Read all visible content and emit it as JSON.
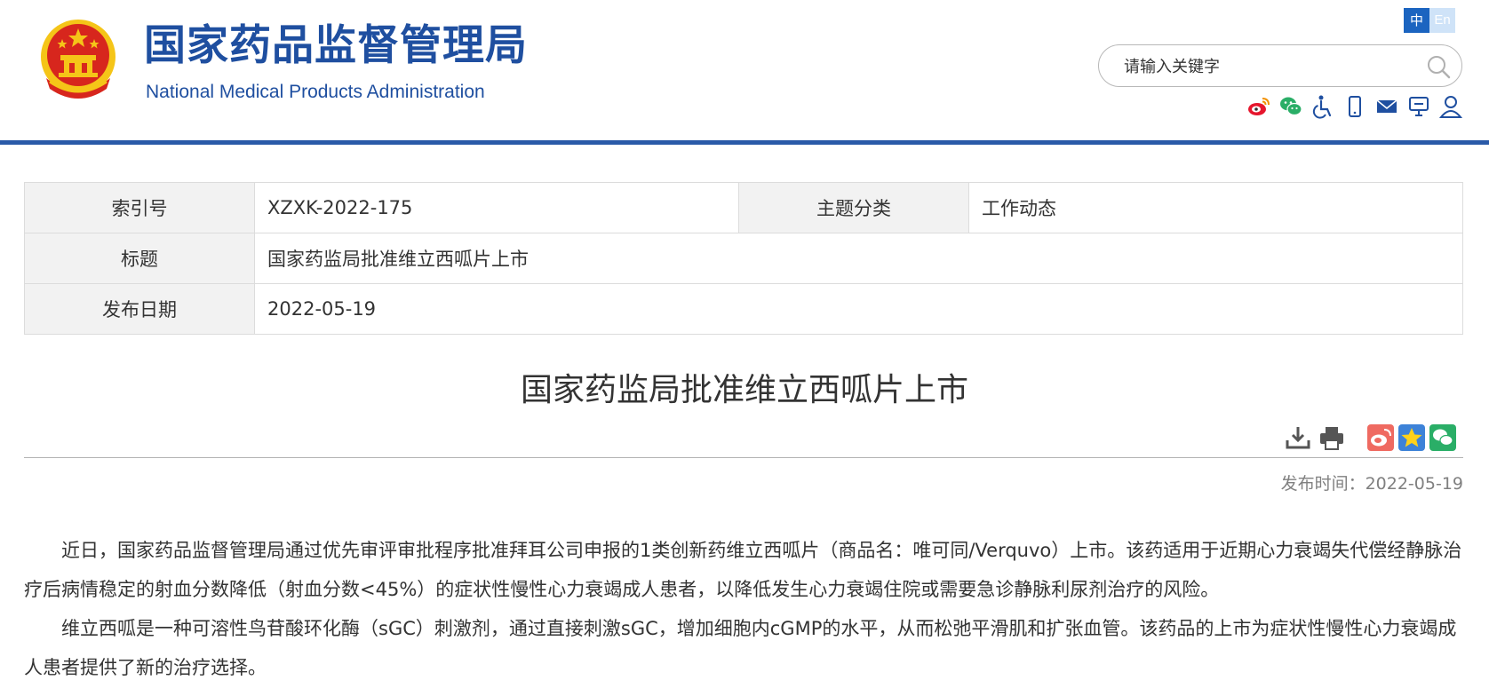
{
  "header": {
    "logo_cn": "国家药品监督管理局",
    "logo_en": "National Medical Products Administration",
    "lang_zh": "中",
    "lang_en": "En",
    "search_placeholder": "请输入关键字",
    "tool_icons": [
      "weibo-icon",
      "wechat-icon",
      "accessibility-icon",
      "mobile-icon",
      "mail-icon",
      "feedback-icon",
      "user-icon"
    ]
  },
  "info": {
    "index_label": "索引号",
    "index_value": "XZXK-2022-175",
    "category_label": "主题分类",
    "category_value": "工作动态",
    "title_label": "标题",
    "title_value": "国家药监局批准维立西呱片上市",
    "date_label": "发布日期",
    "date_value": "2022-05-19"
  },
  "article": {
    "title": "国家药监局批准维立西呱片上市",
    "pubtime": "发布时间：2022-05-19",
    "paragraphs": [
      "近日，国家药品监督管理局通过优先审评审批程序批准拜耳公司申报的1类创新药维立西呱片（商品名：唯可同/Verquvo）上市。该药适用于近期心力衰竭失代偿经静脉治疗后病情稳定的射血分数降低（射血分数<45%）的症状性慢性心力衰竭成人患者，以降低发生心力衰竭住院或需要急诊静脉利尿剂治疗的风险。",
      "维立西呱是一种可溶性鸟苷酸环化酶（sGC）刺激剂，通过直接刺激sGC，增加细胞内cGMP的水平，从而松弛平滑肌和扩张血管。该药品的上市为症状性慢性心力衰竭成人患者提供了新的治疗选择。"
    ],
    "action_icons": [
      "download-icon",
      "print-icon",
      "share-weibo-icon",
      "share-favorite-icon",
      "share-wechat-icon"
    ]
  },
  "colors": {
    "brand_blue": "#1f4fa0",
    "header_rule": "#2a5aa8",
    "emblem_red": "#d7261d",
    "emblem_gold": "#f5c518"
  }
}
